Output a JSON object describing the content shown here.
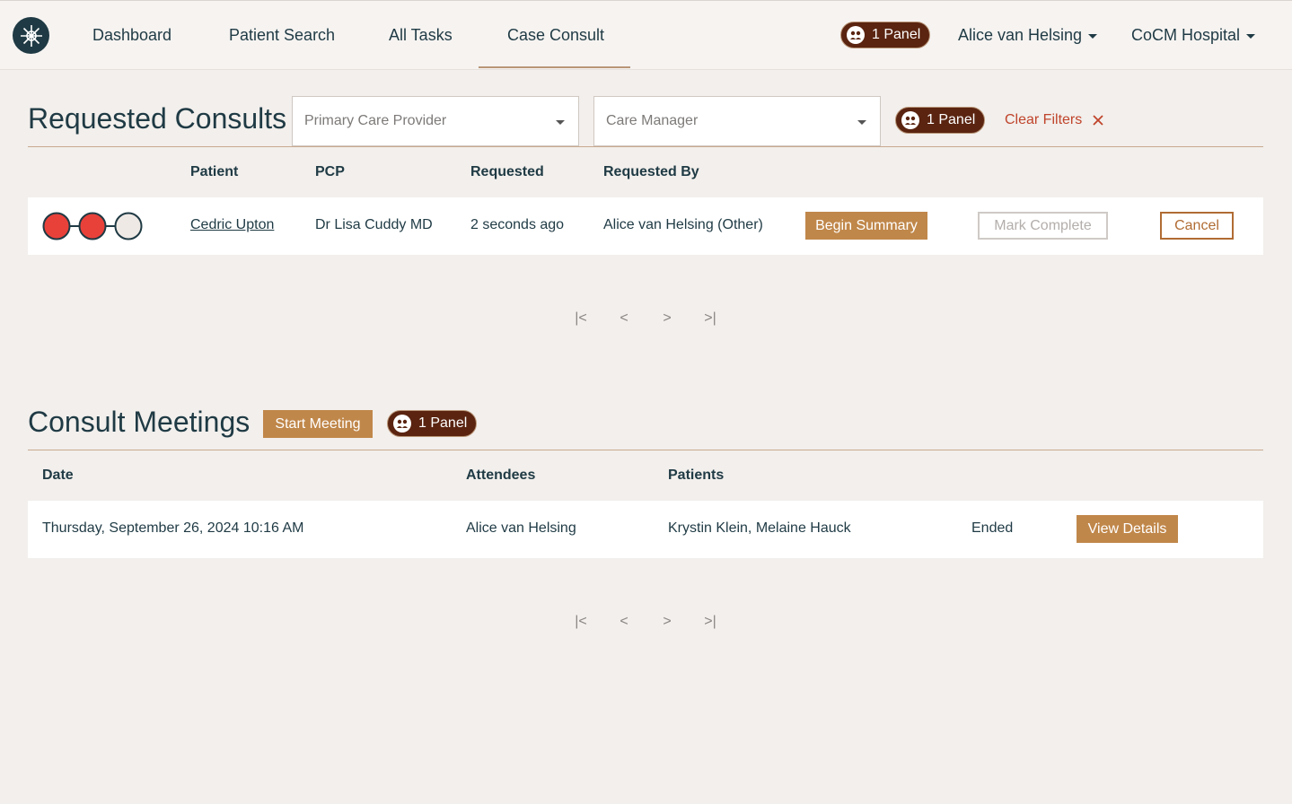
{
  "nav": {
    "items": [
      "Dashboard",
      "Patient Search",
      "All Tasks",
      "Case Consult"
    ],
    "active": "Case Consult",
    "panel_label": "1 Panel",
    "user": "Alice van Helsing",
    "org": "CoCM Hospital"
  },
  "requested": {
    "title": "Requested Consults",
    "pcp_placeholder": "Primary Care Provider",
    "cm_placeholder": "Care Manager",
    "panel_label": "1 Panel",
    "clear_filters": "Clear Filters",
    "columns": [
      "Patient",
      "PCP",
      "Requested",
      "Requested By"
    ],
    "rows": [
      {
        "status_dots": [
          "red",
          "red",
          "empty"
        ],
        "patient": "Cedric Upton",
        "pcp": "Dr Lisa Cuddy MD",
        "requested": "2 seconds ago",
        "requested_by": "Alice van Helsing (Other)",
        "begin_summary": "Begin Summary",
        "mark_complete": "Mark Complete",
        "cancel": "Cancel"
      }
    ]
  },
  "meetings": {
    "title": "Consult Meetings",
    "start_meeting": "Start Meeting",
    "panel_label": "1 Panel",
    "columns": [
      "Date",
      "Attendees",
      "Patients"
    ],
    "rows": [
      {
        "date": "Thursday, September 26, 2024 10:16 AM",
        "attendees": "Alice van Helsing",
        "patients": "Krystin Klein, Melaine Hauck",
        "status": "Ended",
        "view_details": "View Details"
      }
    ]
  },
  "pager": {
    "first": "|<",
    "prev": "<",
    "next": ">",
    "last": ">|"
  },
  "colors": {
    "primary": "#1f3a44",
    "accent": "#c0874a",
    "panel_pill": "#5a2410",
    "danger": "#c0442b",
    "dot_red": "#e8413a"
  }
}
